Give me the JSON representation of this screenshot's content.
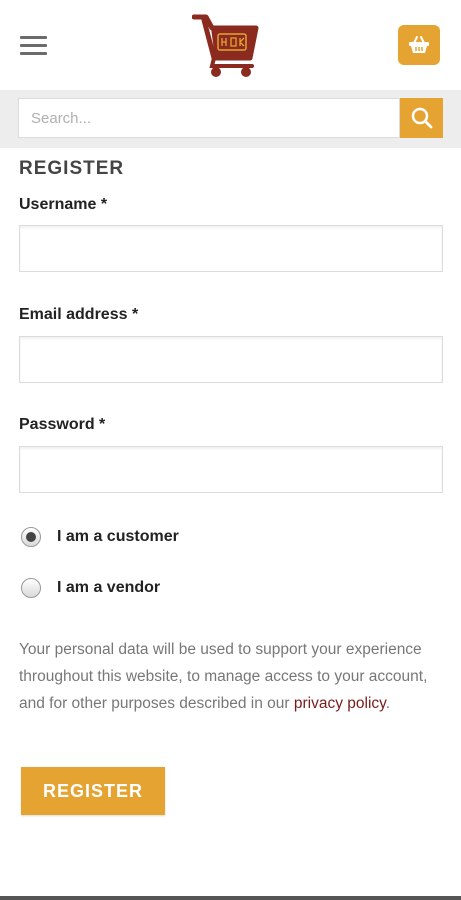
{
  "header": {
    "menu_icon": "hamburger-menu-icon",
    "logo_icon": "shopping-cart-logo",
    "cart_icon": "basket-icon",
    "brand_color": "#e5a332",
    "logo_color": "#8b2a1f"
  },
  "search": {
    "placeholder": "Search...",
    "icon": "search-icon"
  },
  "form": {
    "title": "REGISTER",
    "username_label": "Username *",
    "email_label": "Email address *",
    "password_label": "Password *",
    "roles": [
      {
        "label": "I am a customer",
        "selected": true
      },
      {
        "label": "I am a vendor",
        "selected": false
      }
    ],
    "privacy_text": "Your personal data will be used to support your experience throughout this website, to manage access to your account, and for other purposes described in our ",
    "privacy_link": "privacy policy",
    "privacy_end": ".",
    "register_label": "REGISTER"
  }
}
